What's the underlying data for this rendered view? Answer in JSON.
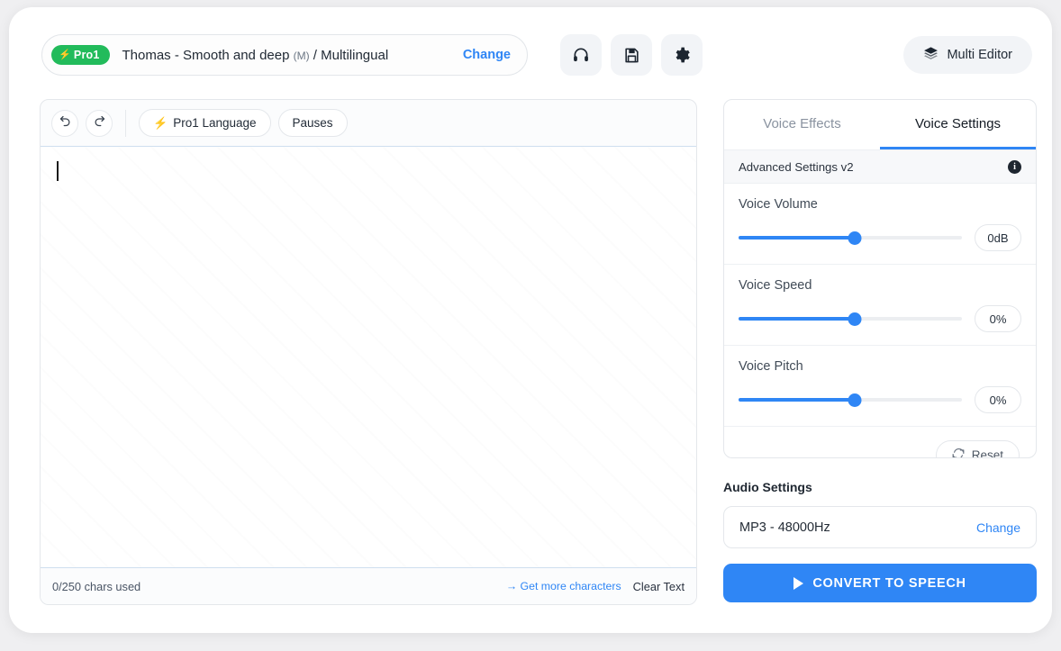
{
  "topbar": {
    "pro_badge": "Pro1",
    "bolt_icon": "lightning-bolt-icon",
    "voice_name": "Thomas - Smooth and deep ",
    "voice_gender": "(M)",
    "voice_lang": " / Multilingual",
    "change_label": "Change",
    "icons": [
      {
        "name": "headphones-icon"
      },
      {
        "name": "save-icon"
      },
      {
        "name": "settings-gear-icon"
      }
    ],
    "multi_editor_label": "Multi Editor",
    "multi_editor_icon": "layers-icon"
  },
  "editor": {
    "undo_icon": "undo-icon",
    "redo_icon": "redo-icon",
    "pro_language_label": "Pro1 Language",
    "pauses_label": "Pauses",
    "text_value": "",
    "placeholder": "",
    "chars_used": "0/250 chars used",
    "get_more_label": "→ Get more characters",
    "clear_text_label": "Clear Text"
  },
  "settings": {
    "tabs": [
      {
        "label": "Voice Effects",
        "active": false
      },
      {
        "label": "Voice Settings",
        "active": true
      }
    ],
    "advanced_label": "Advanced Settings v2",
    "info_icon": "info-icon",
    "sliders": [
      {
        "label": "Voice Volume",
        "value": "0dB",
        "percent": 52
      },
      {
        "label": "Voice Speed",
        "value": "0%",
        "percent": 52
      },
      {
        "label": "Voice Pitch",
        "value": "0%",
        "percent": 52
      }
    ],
    "reset_label": "Reset",
    "reset_icon": "refresh-icon"
  },
  "audio": {
    "heading": "Audio Settings",
    "format": "MP3 - 48000Hz",
    "change_label": "Change"
  },
  "convert": {
    "label": "CONVERT TO SPEECH",
    "icon": "play-icon"
  },
  "colors": {
    "accent": "#2f86f5",
    "pro_green": "#22bb5b",
    "page_bg": "#efeff1"
  }
}
